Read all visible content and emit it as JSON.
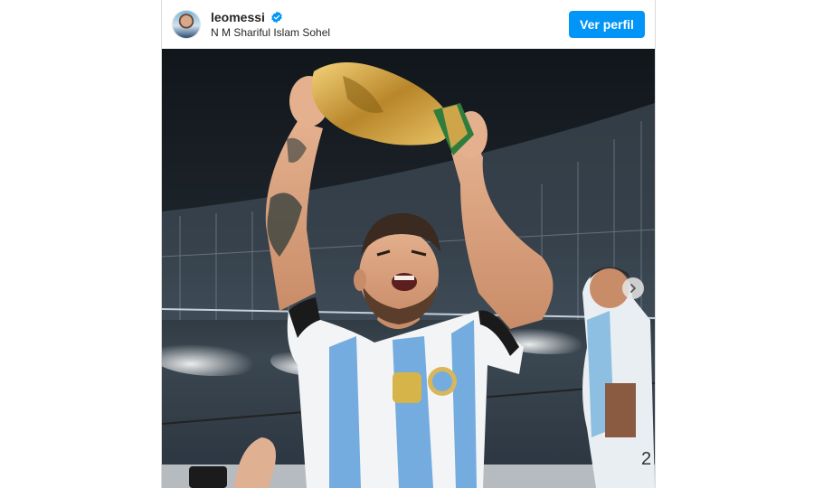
{
  "post": {
    "username": "leomessi",
    "verified": true,
    "subtitle": "N M Shariful Islam Sohel",
    "profile_button_label": "Ver perfil"
  },
  "photo": {
    "jersey_number": "2"
  },
  "icons": {
    "verified": "verified-badge-icon",
    "next": "chevron-right-icon"
  },
  "colors": {
    "accent": "#0095f6",
    "verified": "#0095f6"
  }
}
